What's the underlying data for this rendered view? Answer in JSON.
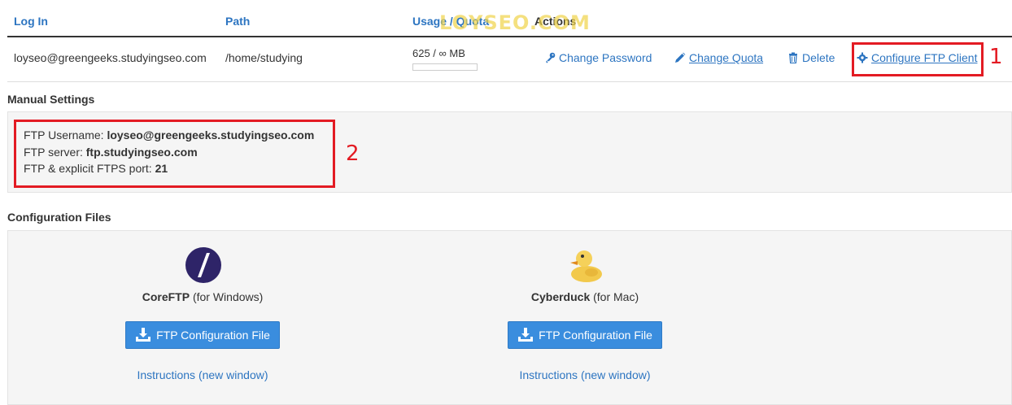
{
  "table": {
    "headers": {
      "login": "Log In",
      "path": "Path",
      "usage": "Usage / Quota",
      "actions": "Actions"
    },
    "row": {
      "login": "loyseo@greengeeks.studyingseo.com",
      "path": "/home/studying",
      "usage": "625 / ∞ MB",
      "usage_fraction": 0.0,
      "actions": {
        "change_password": "Change Password",
        "change_quota": "Change Quota",
        "delete": "Delete",
        "configure": "Configure FTP Client"
      }
    }
  },
  "watermark": "LOYSEO.COM",
  "annotations": {
    "marker1": "1",
    "marker2": "2",
    "color": "#e31b23"
  },
  "manual": {
    "title": "Manual Settings",
    "username_label": "FTP Username:",
    "username_value": "loyseo@greengeeks.studyingseo.com",
    "server_label": "FTP server:",
    "server_value": "ftp.studyingseo.com",
    "port_label": "FTP & explicit FTPS port:",
    "port_value": "21"
  },
  "config": {
    "title": "Configuration Files",
    "clients": [
      {
        "name": "CoreFTP",
        "platform": "(for Windows)",
        "button": "FTP Configuration File",
        "instructions": "Instructions (new window)",
        "icon": "coreftp-logo-icon"
      },
      {
        "name": "Cyberduck",
        "platform": "(for Mac)",
        "button": "FTP Configuration File",
        "instructions": "Instructions (new window)",
        "icon": "cyberduck-logo-icon"
      }
    ]
  },
  "colors": {
    "link": "#2d75c1",
    "button": "#3a8dde",
    "well": "#f5f5f5"
  }
}
